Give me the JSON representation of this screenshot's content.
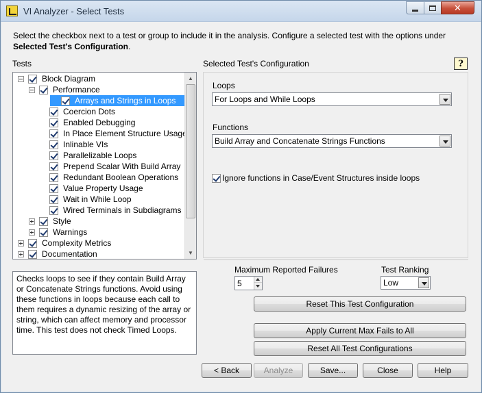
{
  "window": {
    "title": "VI Analyzer - Select Tests",
    "controls": {
      "minimize": "minimize",
      "maximize": "maximize",
      "close": "✕"
    }
  },
  "instructions": {
    "line1": "Select the checkbox next to a test or group to include it in the analysis.  Configure a selected test with the options under",
    "line2_bold": "Selected Test's Configuration",
    "line2_end": "."
  },
  "tests": {
    "label": "Tests",
    "items": [
      {
        "label": "Block Diagram",
        "level": 0,
        "expander": "minus",
        "checked": true
      },
      {
        "label": "Performance",
        "level": 1,
        "expander": "minus",
        "checked": true
      },
      {
        "label": "Arrays and Strings in Loops",
        "level": 2,
        "checked": true,
        "selected": true
      },
      {
        "label": "Coercion Dots",
        "level": 2,
        "checked": true
      },
      {
        "label": "Enabled Debugging",
        "level": 2,
        "checked": true
      },
      {
        "label": "In Place Element Structure Usage",
        "level": 2,
        "checked": true
      },
      {
        "label": "Inlinable VIs",
        "level": 2,
        "checked": true
      },
      {
        "label": "Parallelizable Loops",
        "level": 2,
        "checked": true
      },
      {
        "label": "Prepend Scalar With Build Array",
        "level": 2,
        "checked": true
      },
      {
        "label": "Redundant Boolean Operations",
        "level": 2,
        "checked": true
      },
      {
        "label": "Value Property Usage",
        "level": 2,
        "checked": true
      },
      {
        "label": "Wait in While Loop",
        "level": 2,
        "checked": true
      },
      {
        "label": "Wired Terminals in Subdiagrams",
        "level": 2,
        "checked": true
      },
      {
        "label": "Style",
        "level": 1,
        "expander": "plus",
        "checked": true
      },
      {
        "label": "Warnings",
        "level": 1,
        "expander": "plus",
        "checked": true
      },
      {
        "label": "Complexity Metrics",
        "level": 0,
        "expander": "plus",
        "checked": true
      },
      {
        "label": "Documentation",
        "level": 0,
        "expander": "plus",
        "checked": true
      }
    ]
  },
  "description": "Checks loops to see if they contain Build Array or Concatenate Strings functions. Avoid using these functions in loops because each call to them requires a dynamic resizing of the array or string, which can affect memory and processor time.  This test does not check Timed Loops.",
  "config": {
    "label": "Selected Test's Configuration",
    "loops_label": "Loops",
    "loops_value": "For Loops and While Loops",
    "functions_label": "Functions",
    "functions_value": "Build Array and Concatenate Strings Functions",
    "ignore_label": "Ignore functions in Case/Event Structures inside loops",
    "ignore_checked": true
  },
  "failures": {
    "label": "Maximum Reported Failures",
    "value": "5"
  },
  "ranking": {
    "label": "Test Ranking",
    "value": "Low"
  },
  "buttons": {
    "reset_test": "Reset This Test Configuration",
    "apply_max": "Apply Current Max Fails to All",
    "reset_all": "Reset All Test Configurations",
    "back": "< Back",
    "analyze": "Analyze",
    "save": "Save...",
    "close": "Close",
    "help": "Help"
  },
  "colors": {
    "selection": "#3399ff",
    "window_bg": "#f0f0f0",
    "close_button": "#c7503a"
  }
}
